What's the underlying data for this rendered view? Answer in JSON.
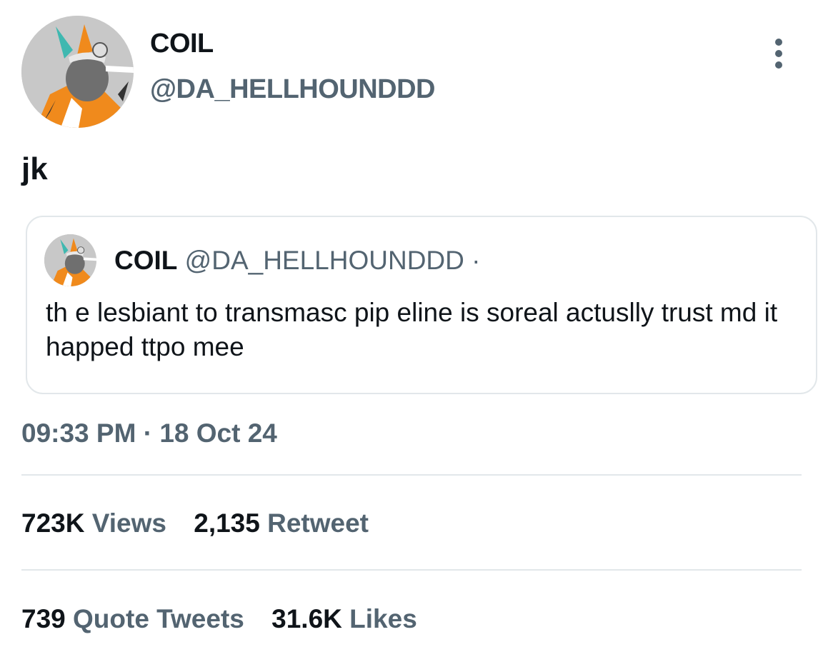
{
  "author": {
    "display_name": "COIL",
    "handle": "@DA_HELLHOUNDDD"
  },
  "tweet": {
    "text": "jk"
  },
  "quoted": {
    "display_name": "COIL",
    "handle": "@DA_HELLHOUNDDD",
    "separator": "·",
    "text": "th e lesbiant to transmasc pip eline is soreal actuslly trust md it happed ttpo mee"
  },
  "meta": {
    "time": "09:33 PM",
    "separator": "·",
    "date": "18 Oct 24"
  },
  "stats": {
    "views_count": "723K",
    "views_label": "Views",
    "retweets_count": "2,135",
    "retweets_label": "Retweet",
    "quotes_count": "739",
    "quotes_label": "Quote Tweets",
    "likes_count": "31.6K",
    "likes_label": "Likes"
  },
  "icons": {
    "avatar": "avatar-illustration-icon",
    "more": "more-vertical-icon"
  },
  "colors": {
    "text_primary": "#0f1419",
    "text_secondary": "#536471",
    "border": "#e2e7ea",
    "avatar_orange": "#f08a1c",
    "avatar_teal": "#3fb8b0"
  }
}
